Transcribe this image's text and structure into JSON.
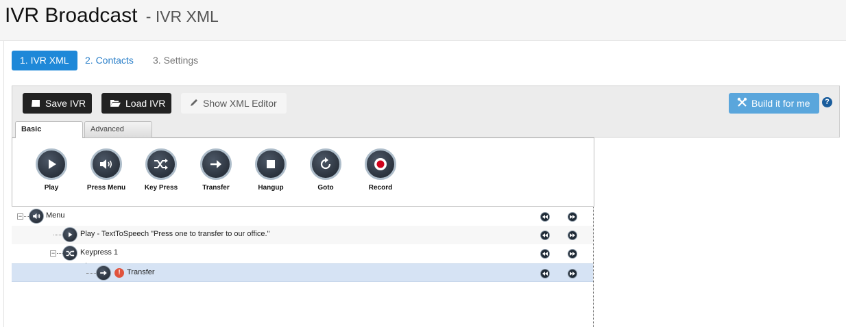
{
  "header": {
    "title": "IVR Broadcast",
    "subtitle": "- IVR XML"
  },
  "wizard": {
    "tabs": [
      {
        "label": "1. IVR XML",
        "active": true
      },
      {
        "label": "2. Contacts",
        "active": false
      },
      {
        "label": "3. Settings",
        "active": false
      }
    ]
  },
  "toolbar": {
    "save_label": "Save IVR",
    "load_label": "Load IVR",
    "xml_editor_label": "Show XML Editor",
    "build_label": "Build it for me",
    "help": "?"
  },
  "mode_tabs": {
    "basic": "Basic",
    "advanced": "Advanced"
  },
  "palette": {
    "items": [
      {
        "label": "Play",
        "icon": "play-icon"
      },
      {
        "label": "Press Menu",
        "icon": "speaker-icon"
      },
      {
        "label": "Key Press",
        "icon": "shuffle-icon"
      },
      {
        "label": "Transfer",
        "icon": "arrow-right-icon"
      },
      {
        "label": "Hangup",
        "icon": "stop-icon"
      },
      {
        "label": "Goto",
        "icon": "refresh-icon"
      },
      {
        "label": "Record",
        "icon": "record-icon"
      }
    ]
  },
  "tree": {
    "nodes": [
      {
        "label": "Menu",
        "icon": "speaker-icon",
        "level": 0,
        "expanded": true
      },
      {
        "label": "Play - TextToSpeech \"Press one to transfer to our office.\"",
        "icon": "play-icon",
        "level": 1
      },
      {
        "label": "Keypress 1",
        "icon": "shuffle-icon",
        "level": 1,
        "expanded": true
      },
      {
        "label": "Transfer",
        "icon": "arrow-right-icon",
        "level": 2,
        "warning": true,
        "selected": true
      }
    ]
  },
  "colors": {
    "primary": "#1e88d8",
    "build": "#5aa6dc",
    "selected_row": "#d6e3f4",
    "warning": "#e0533d"
  }
}
